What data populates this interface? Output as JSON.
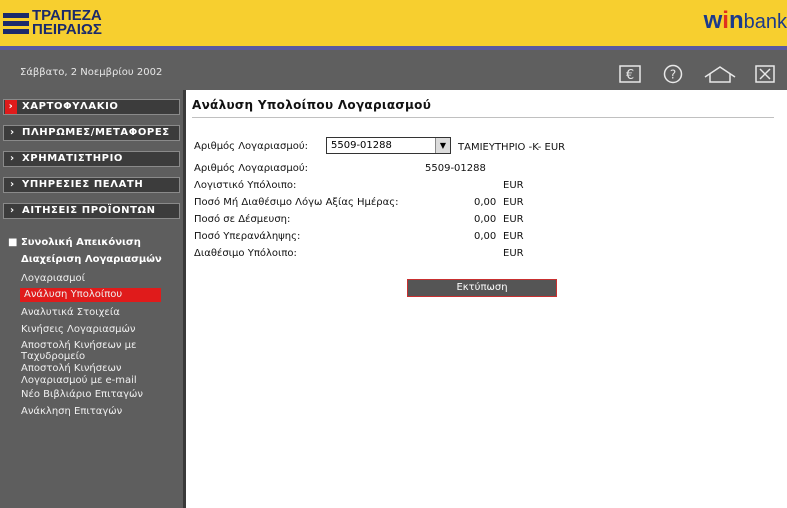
{
  "header": {
    "logo_line1": "ΤΡΑΠΕΖΑ",
    "logo_line2": "ΠΕΙΡΑΙΩΣ",
    "brand_w": "w",
    "brand_i": "i",
    "brand_n": "n",
    "brand_bank": "bank",
    "date": "Σάββατο, 2 Νοεμβρίου 2002",
    "icons": [
      "euro-icon",
      "help-icon",
      "home-icon",
      "close-icon"
    ],
    "euro_symbol": "€",
    "help_symbol": "?"
  },
  "sidebar": {
    "nav": [
      {
        "label": "ΧΑΡΤΟΦΥΛΑΚΙΟ",
        "active": true
      },
      {
        "label": "ΠΛΗΡΩΜΕΣ/ΜΕΤΑΦΟΡΕΣ",
        "active": false
      },
      {
        "label": "ΧΡΗΜΑΤΙΣΤΗΡΙΟ",
        "active": false
      },
      {
        "label": "ΥΠΗΡΕΣΙΕΣ ΠΕΛΑΤΗ",
        "active": false
      },
      {
        "label": "ΑΙΤΗΣΕΙΣ ΠΡΟΪΟΝΤΩΝ",
        "active": false
      }
    ],
    "section_title": "Συνολική Απεικόνιση",
    "section_subtitle": "Διαχείριση Λογαριασμών",
    "links": [
      "Λογαριασμοί",
      "Ανάλυση Υπολοίπου",
      "Αναλυτικά Στοιχεία",
      "Κινήσεις Λογαριασμών",
      "Αποστολή Κινήσεων με",
      "Ταχυδρομείο",
      "Αποστολή Κινήσεων",
      "Λογαριασμού με e-mail",
      "Νέο Βιβλιάριο Επιταγών",
      "Ανάκληση Επιταγών"
    ]
  },
  "main": {
    "title": "Ανάλυση Υπολοίπου Λογαριασμού",
    "account_select_label": "Αριθμός Λογαριασμού:",
    "account_select_value": "5509-01288",
    "account_type": "ΤΑΜΙΕΥΤΗΡΙΟ -K- EUR",
    "rows": [
      {
        "label": "Αριθμός Λογαριασμού:",
        "amount": "5509-01288",
        "currency": ""
      },
      {
        "label": "Λογιστικό Υπόλοιπο:",
        "amount": "",
        "currency": "EUR"
      },
      {
        "label": "Ποσό Μή Διαθέσιμο Λόγω Αξίας Ημέρας:",
        "amount": "0,00",
        "currency": "EUR"
      },
      {
        "label": "Ποσό σε Δέσμευση:",
        "amount": "0,00",
        "currency": "EUR"
      },
      {
        "label": "Ποσό Υπερανάληψης:",
        "amount": "0,00",
        "currency": "EUR"
      },
      {
        "label": "Διαθέσιμο Υπόλοιπο:",
        "amount": "",
        "currency": "EUR"
      }
    ],
    "print_button": "Εκτύπωση"
  }
}
